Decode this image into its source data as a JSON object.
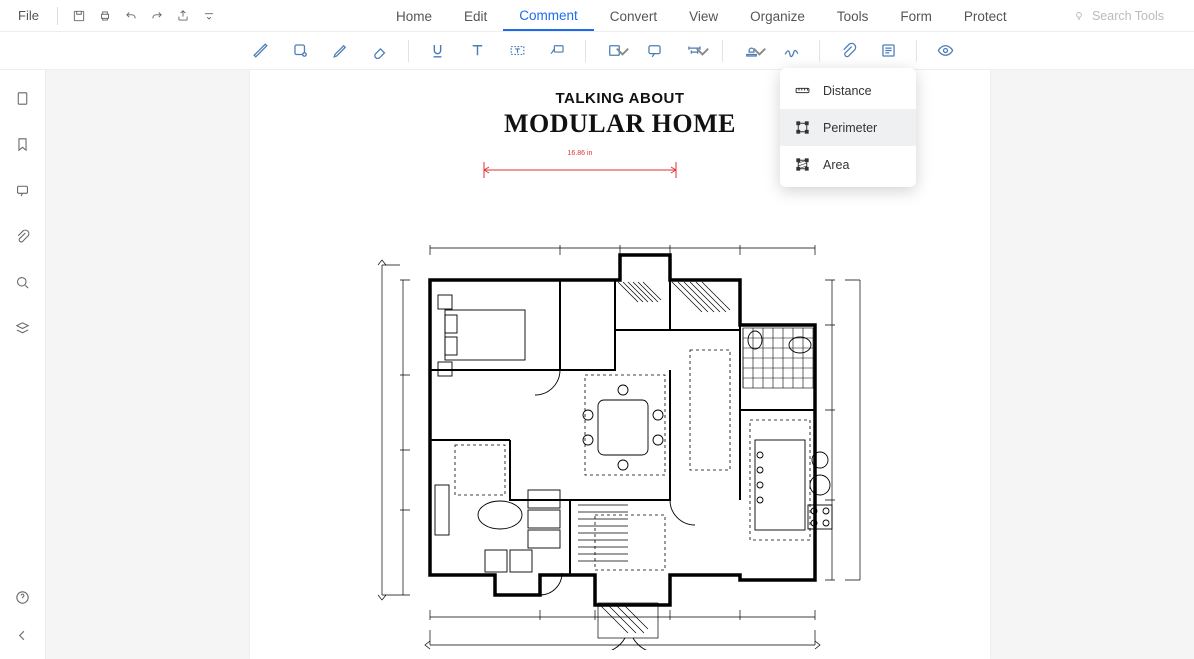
{
  "file_menu": "File",
  "menubar": {
    "home": "Home",
    "edit": "Edit",
    "comment": "Comment",
    "convert": "Convert",
    "view": "View",
    "organize": "Organize",
    "tools": "Tools",
    "form": "Form",
    "protect": "Protect"
  },
  "search_placeholder": "Search Tools",
  "document": {
    "title_line1": "TALKING ABOUT",
    "title_line2": "MODULAR HOME"
  },
  "measure_menu": {
    "distance": "Distance",
    "perimeter": "Perimeter",
    "area": "Area"
  },
  "measurement_label": "16.86 in"
}
